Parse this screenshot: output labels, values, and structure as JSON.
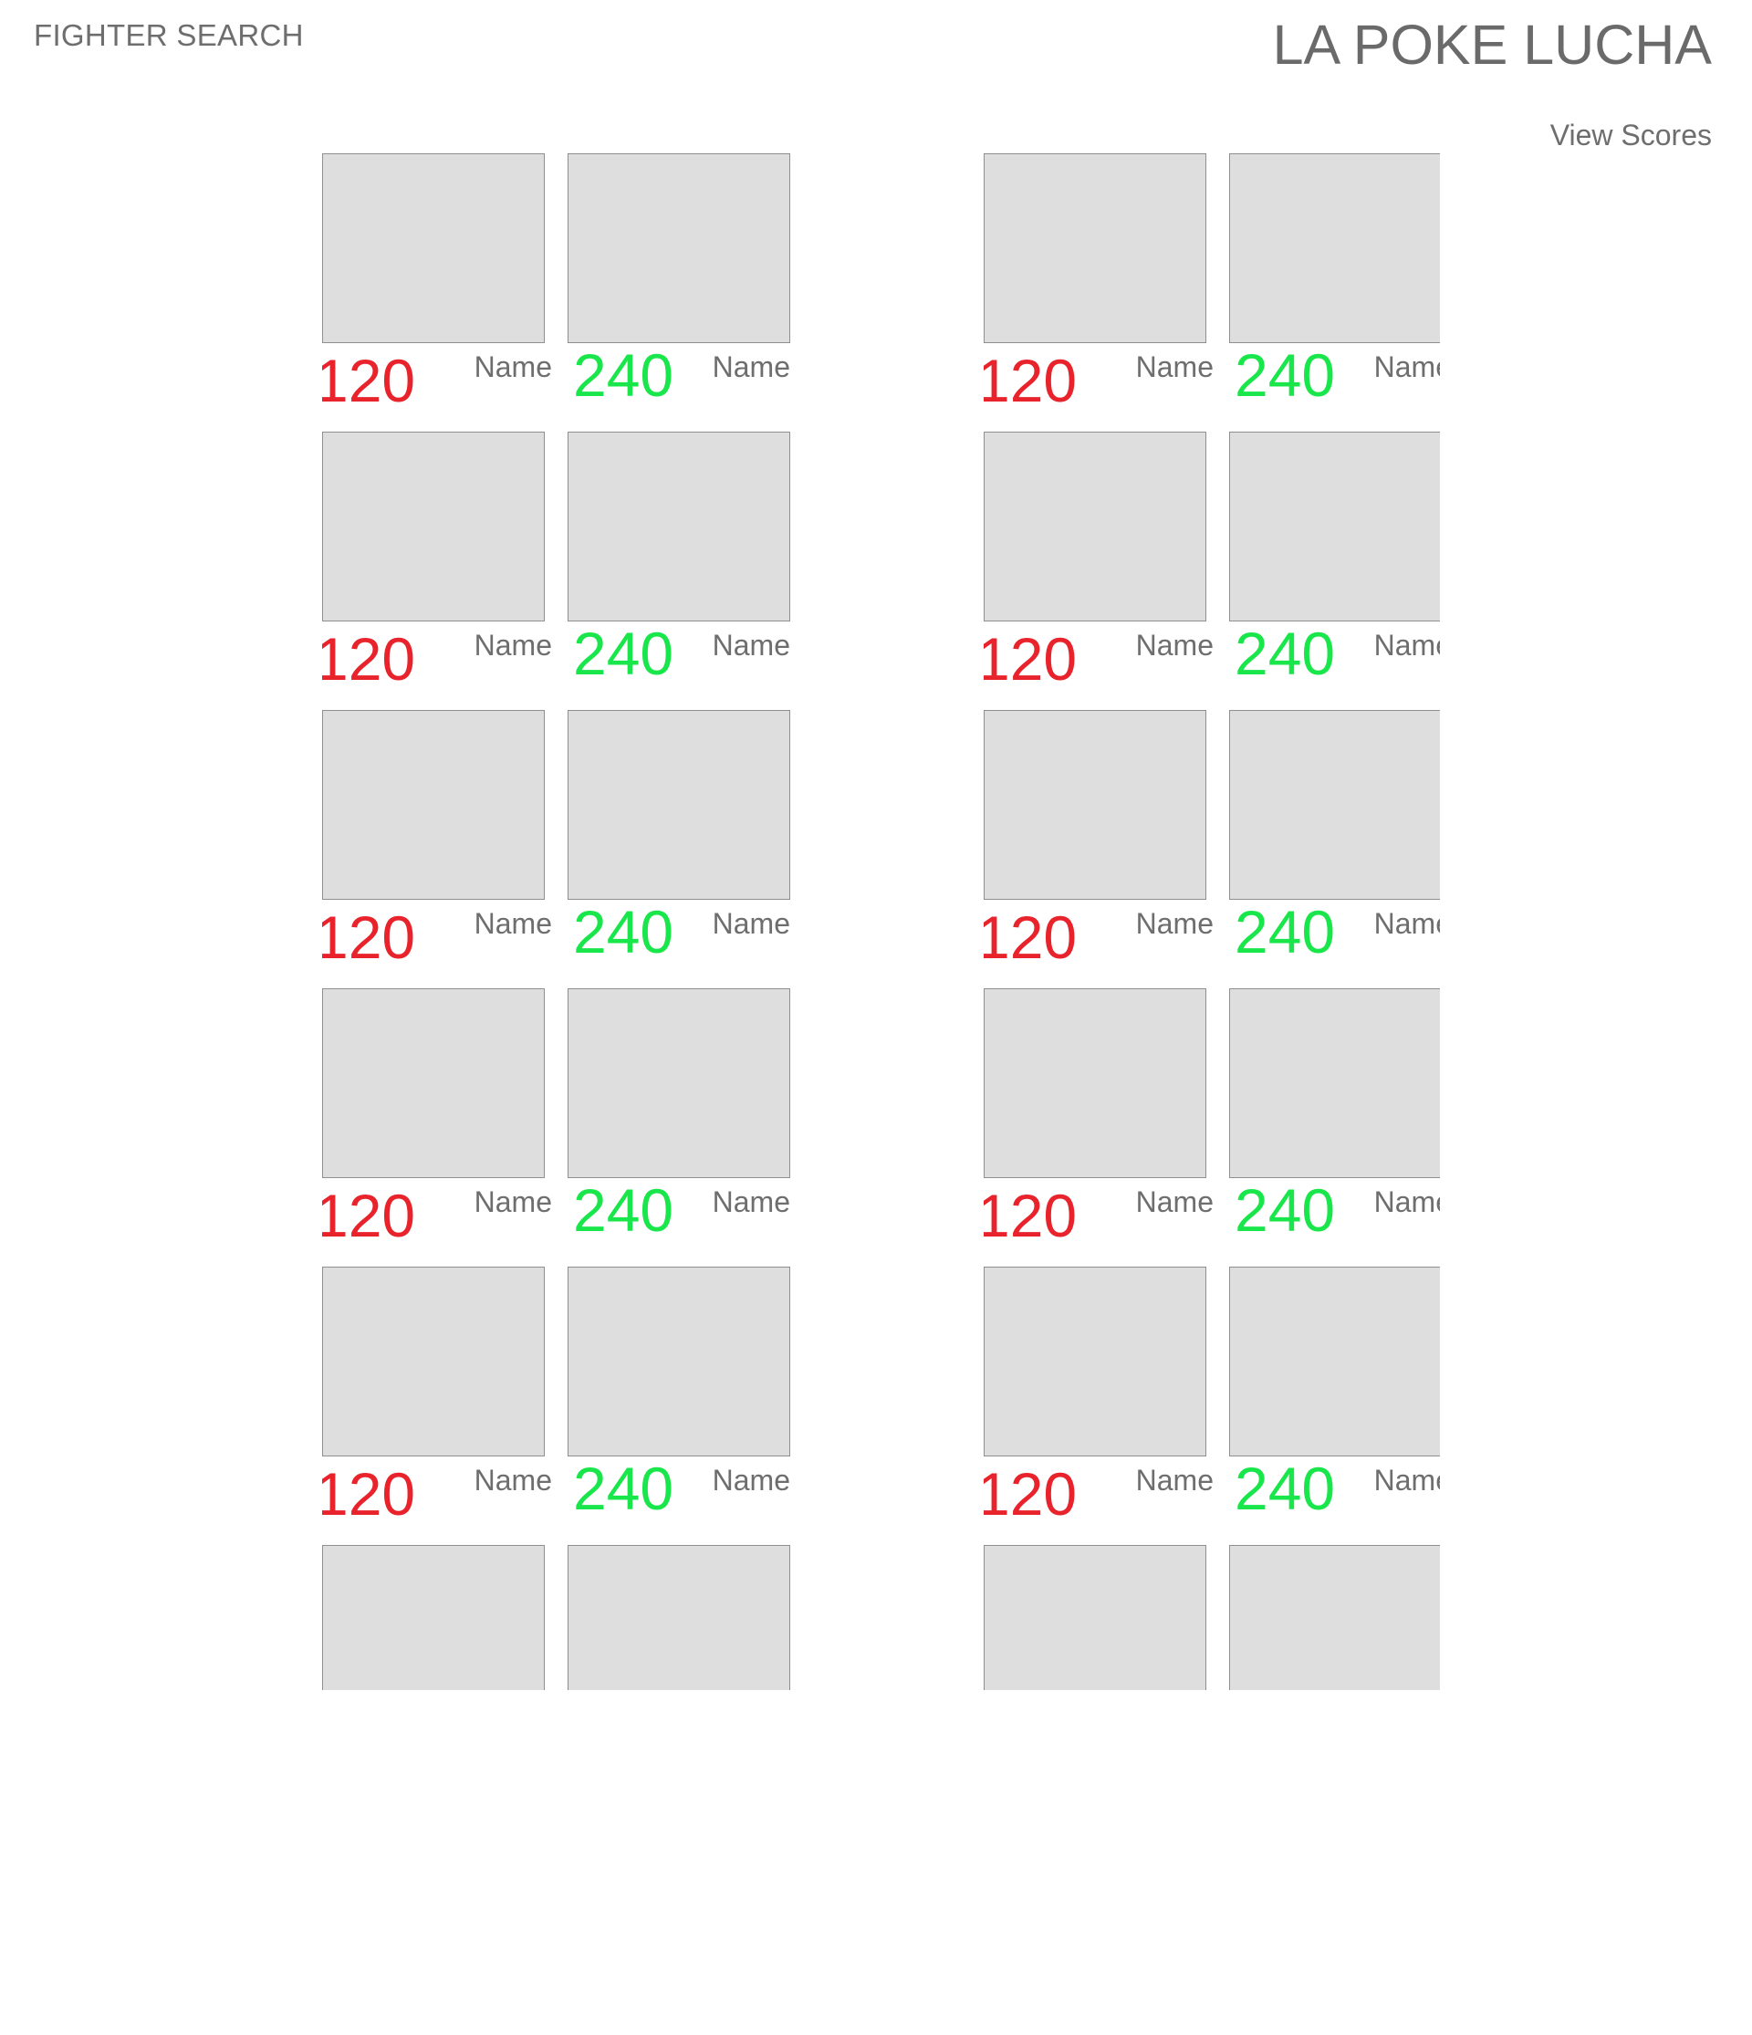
{
  "header": {
    "nav_label": "FIGHTER SEARCH",
    "title": "LA POKE LUCHA",
    "view_scores_label": "View Scores"
  },
  "colors": {
    "low_score": "#e8232b",
    "high_score": "#19e64a",
    "thumbnail_bg": "#dedede",
    "text": "#6e6e6e"
  },
  "panels": [
    {
      "rows": [
        {
          "cards": [
            {
              "score": "120",
              "name": "Name",
              "tone": "red"
            },
            {
              "score": "240",
              "name": "Name",
              "tone": "green"
            }
          ]
        },
        {
          "cards": [
            {
              "score": "120",
              "name": "Name",
              "tone": "red"
            },
            {
              "score": "240",
              "name": "Name",
              "tone": "green"
            }
          ]
        },
        {
          "cards": [
            {
              "score": "120",
              "name": "Name",
              "tone": "red"
            },
            {
              "score": "240",
              "name": "Name",
              "tone": "green"
            }
          ]
        },
        {
          "cards": [
            {
              "score": "120",
              "name": "Name",
              "tone": "red"
            },
            {
              "score": "240",
              "name": "Name",
              "tone": "green"
            }
          ]
        },
        {
          "cards": [
            {
              "score": "120",
              "name": "Name",
              "tone": "red"
            },
            {
              "score": "240",
              "name": "Name",
              "tone": "green"
            }
          ]
        },
        {
          "cards": [
            {
              "score": "",
              "name": "",
              "tone": "red"
            },
            {
              "score": "",
              "name": "",
              "tone": "green"
            }
          ]
        }
      ]
    },
    {
      "rows": [
        {
          "cards": [
            {
              "score": "120",
              "name": "Name",
              "tone": "red"
            },
            {
              "score": "240",
              "name": "Name",
              "tone": "green"
            }
          ]
        },
        {
          "cards": [
            {
              "score": "120",
              "name": "Name",
              "tone": "red"
            },
            {
              "score": "240",
              "name": "Name",
              "tone": "green"
            }
          ]
        },
        {
          "cards": [
            {
              "score": "120",
              "name": "Name",
              "tone": "red"
            },
            {
              "score": "240",
              "name": "Name",
              "tone": "green"
            }
          ]
        },
        {
          "cards": [
            {
              "score": "120",
              "name": "Name",
              "tone": "red"
            },
            {
              "score": "240",
              "name": "Name",
              "tone": "green"
            }
          ]
        },
        {
          "cards": [
            {
              "score": "120",
              "name": "Name",
              "tone": "red"
            },
            {
              "score": "240",
              "name": "Name",
              "tone": "green"
            }
          ]
        },
        {
          "cards": [
            {
              "score": "",
              "name": "",
              "tone": "red"
            },
            {
              "score": "",
              "name": "",
              "tone": "green"
            }
          ]
        }
      ]
    }
  ]
}
